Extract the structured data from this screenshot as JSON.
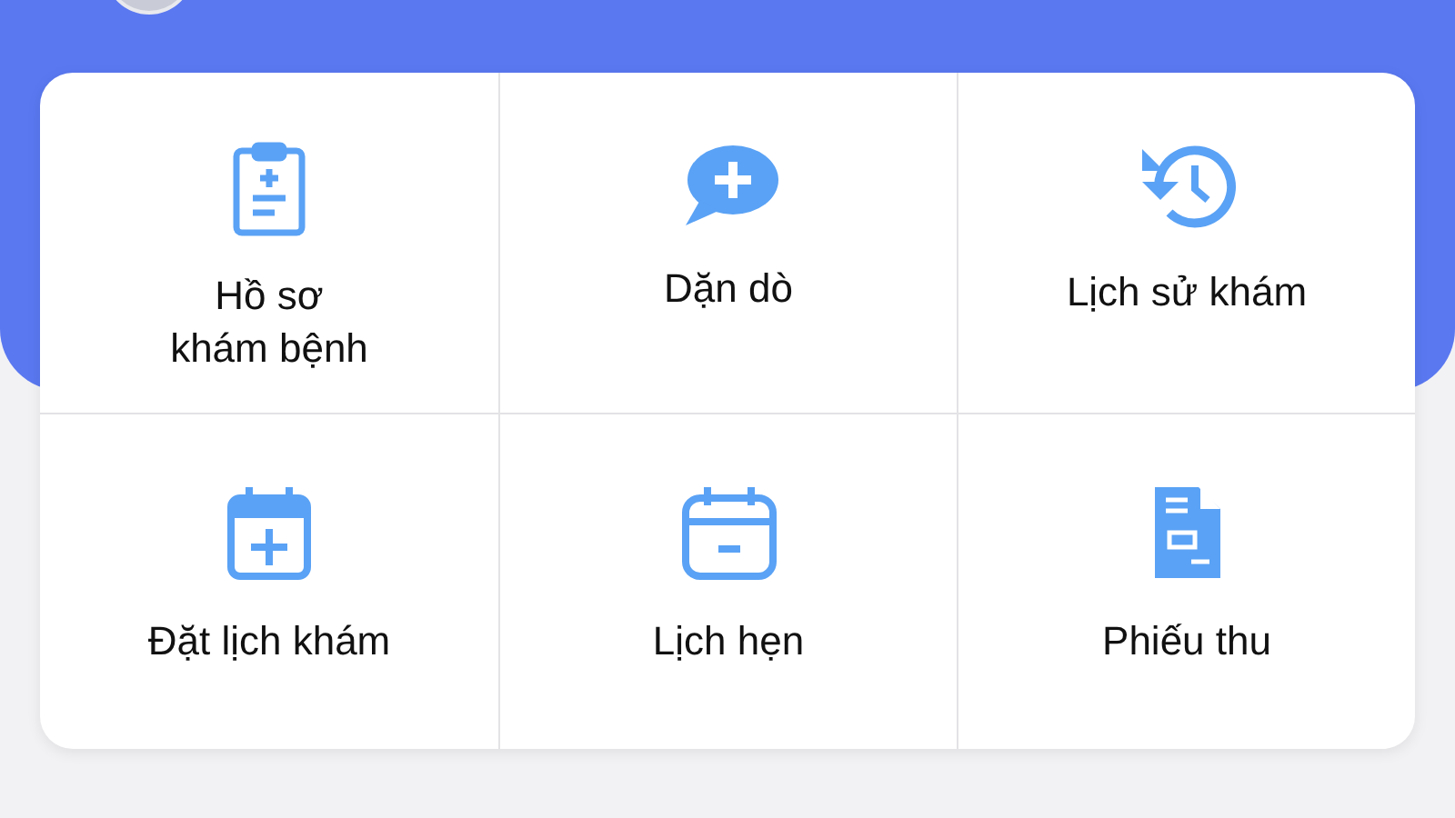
{
  "menu": [
    {
      "label": "Hồ sơ\nkhám bệnh"
    },
    {
      "label": "Dặn dò"
    },
    {
      "label": "Lịch sử khám"
    },
    {
      "label": "Đặt lịch khám"
    },
    {
      "label": "Lịch hẹn"
    },
    {
      "label": "Phiếu thu"
    }
  ]
}
